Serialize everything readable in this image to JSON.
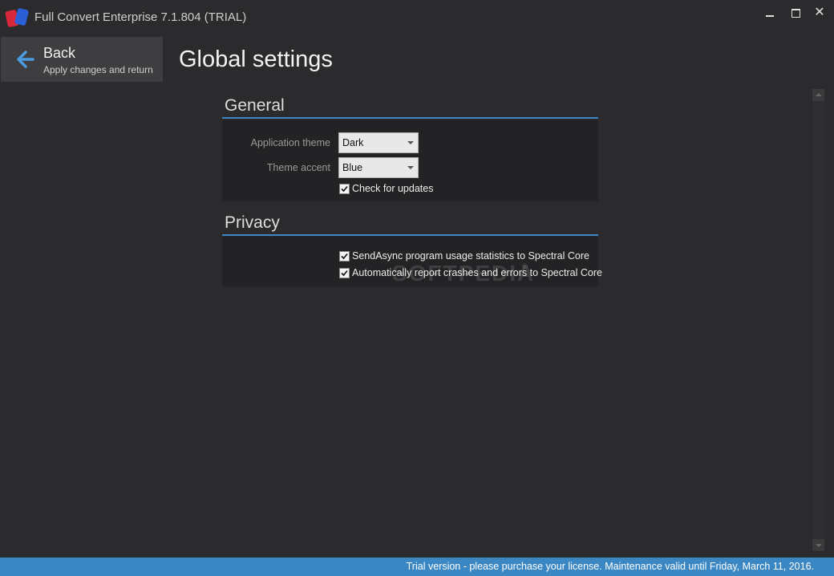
{
  "window": {
    "title": "Full Convert Enterprise 7.1.804 (TRIAL)",
    "controls": {
      "minimize": "minimize",
      "maximize": "maximize",
      "close": "✕"
    }
  },
  "back": {
    "title": "Back",
    "subtitle": "Apply changes and return",
    "icon": "arrow-left-icon"
  },
  "page": {
    "title": "Global settings"
  },
  "general": {
    "header": "General",
    "theme_label": "Application theme",
    "theme_value": "Dark",
    "accent_label": "Theme accent",
    "accent_value": "Blue",
    "check_updates_label": "Check for updates",
    "check_updates_checked": true
  },
  "privacy": {
    "header": "Privacy",
    "usage_stats_label": "SendAsync program usage statistics to Spectral Core",
    "usage_stats_checked": true,
    "crash_report_label": "Automatically report crashes and errors to Spectral Core",
    "crash_report_checked": true
  },
  "watermark": {
    "text": "SOFTPEDIA",
    "mark": "®"
  },
  "status": {
    "text": "Trial version - please purchase your license. Maintenance valid until Friday, March 11, 2016."
  },
  "colors": {
    "accent": "#3a87c4",
    "background": "#2b2b2d",
    "panel": "#232325"
  }
}
